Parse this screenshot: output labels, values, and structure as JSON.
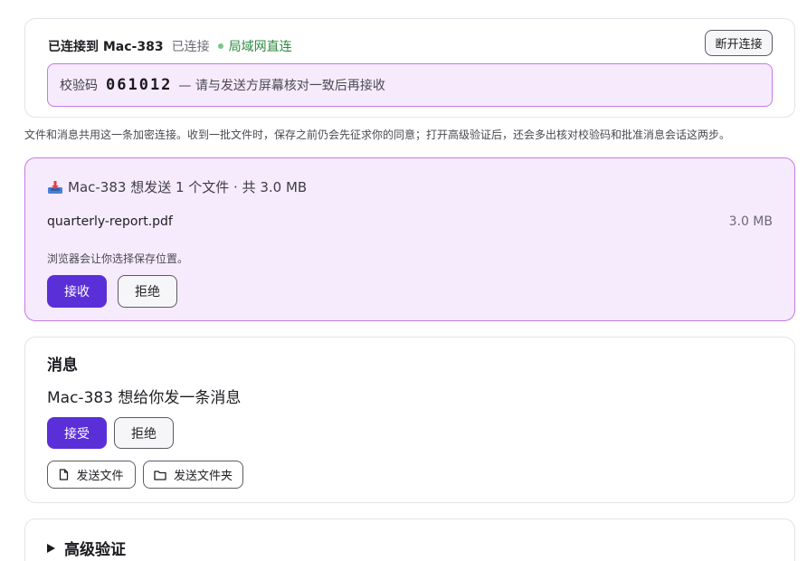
{
  "connection": {
    "title": "已连接到 Mac-383",
    "state": "已连接",
    "network": "局域网直连",
    "disconnect_label": "断开连接",
    "code_label": "校验码",
    "code_value": "061012",
    "code_note": "— 请与发送方屏幕核对一致后再接收"
  },
  "explain_text": "文件和消息共用这一条加密连接。收到一批文件时，保存之前仍会先征求你的同意；打开高级验证后，还会多出核对校验码和批准消息会话这两步。",
  "file_offer": {
    "icon": "inbox-tray-icon",
    "heading": "Mac-383 想发送 1 个文件 · 共 3.0 MB",
    "file_name": "quarterly-report.pdf",
    "file_size": "3.0 MB",
    "hint": "浏览器会让你选择保存位置。",
    "accept_label": "接收",
    "reject_label": "拒绝"
  },
  "messages": {
    "title": "消息",
    "request_text": "Mac-383 想给你发一条消息",
    "accept_label": "接受",
    "reject_label": "拒绝",
    "send_file_label": "发送文件",
    "send_folder_label": "发送文件夹"
  },
  "advanced": {
    "title": "高级验证"
  },
  "colors": {
    "accent": "#5b2fd8",
    "highlight_bg": "#f6eafd",
    "highlight_border": "#c27be6",
    "status_green": "#2f8a3f"
  }
}
